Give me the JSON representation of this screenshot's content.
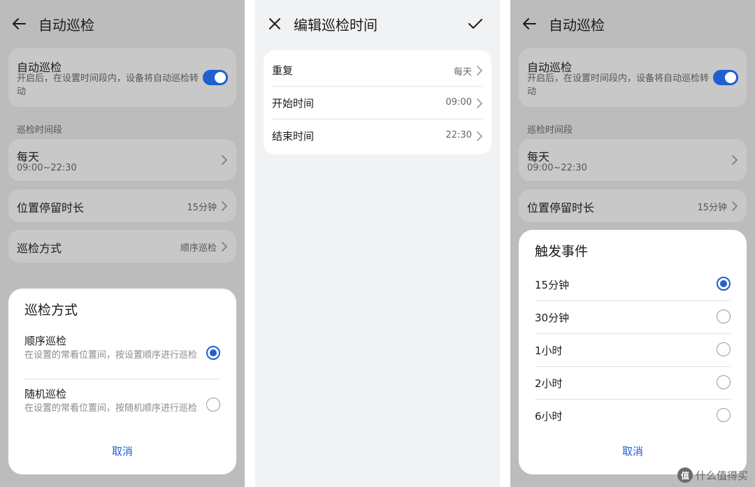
{
  "panel1": {
    "title": "自动巡检",
    "auto": {
      "label": "自动巡检",
      "desc": "开启后，在设置时间段内，设备将自动巡检转动",
      "enabled": true
    },
    "period_label": "巡检时间段",
    "period": {
      "days": "每天",
      "range": "09:00~22:30"
    },
    "dwell": {
      "label": "位置停留时长",
      "value": "15分钟"
    },
    "mode": {
      "label": "巡检方式",
      "value": "顺序巡检"
    },
    "sheet": {
      "title": "巡检方式",
      "options": [
        {
          "label": "顺序巡检",
          "desc": "在设置的常看位置间，按设置顺序进行巡检",
          "selected": true
        },
        {
          "label": "随机巡检",
          "desc": "在设置的常看位置间，按随机顺序进行巡检",
          "selected": false
        }
      ],
      "cancel": "取消"
    }
  },
  "panel2": {
    "title": "编辑巡检时间",
    "rows": [
      {
        "label": "重复",
        "value": "每天"
      },
      {
        "label": "开始时间",
        "value": "09:00"
      },
      {
        "label": "结束时间",
        "value": "22:30"
      }
    ]
  },
  "panel3": {
    "title": "自动巡检",
    "auto": {
      "label": "自动巡检",
      "desc": "开启后，在设置时间段内，设备将自动巡检转动",
      "enabled": true
    },
    "period_label": "巡检时间段",
    "period": {
      "days": "每天",
      "range": "09:00~22:30"
    },
    "dwell": {
      "label": "位置停留时长",
      "value": "15分钟"
    },
    "sheet": {
      "title": "触发事件",
      "options": [
        {
          "label": "15分钟",
          "selected": true
        },
        {
          "label": "30分钟",
          "selected": false
        },
        {
          "label": "1小时",
          "selected": false
        },
        {
          "label": "2小时",
          "selected": false
        },
        {
          "label": "6小时",
          "selected": false
        }
      ],
      "cancel": "取消"
    }
  },
  "watermark": {
    "logo": "值",
    "text": "什么值得买"
  },
  "colors": {
    "accent": "#1f5fd1",
    "dim_bg": "#bcbcbc",
    "panel2_bg": "#f1f2f4"
  }
}
